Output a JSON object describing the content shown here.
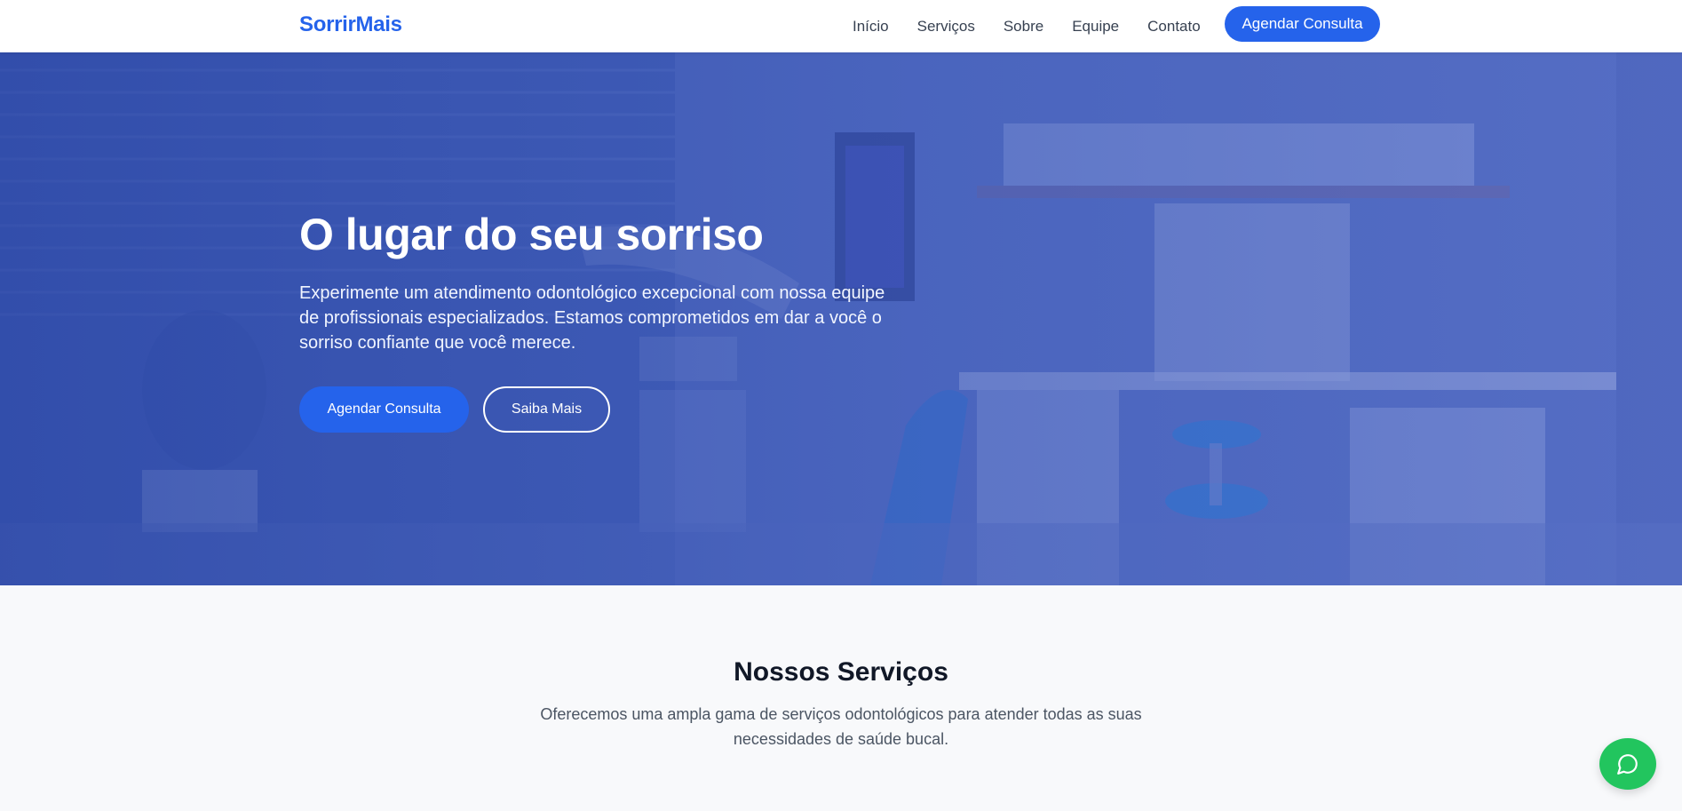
{
  "header": {
    "logo": "SorrirMais",
    "nav": [
      "Início",
      "Serviços",
      "Sobre",
      "Equipe",
      "Contato"
    ],
    "cta": "Agendar Consulta"
  },
  "hero": {
    "title": "O lugar do seu sorriso",
    "text": "Experimente um atendimento odontológico excepcional com nossa equipe de profissionais especializados. Estamos comprometidos em dar a você o sorriso confiante que você merece.",
    "primary_button": "Agendar Consulta",
    "secondary_button": "Saiba Mais"
  },
  "services": {
    "title": "Nossos Serviços",
    "text": "Oferecemos uma ampla gama de serviços odontológicos para atender todas as suas necessidades de saúde bucal."
  },
  "chat": {
    "icon": "message-circle-icon"
  },
  "colors": {
    "brand": "#2563eb",
    "chat": "#22c55e",
    "overlay": "#3b5ab8"
  }
}
